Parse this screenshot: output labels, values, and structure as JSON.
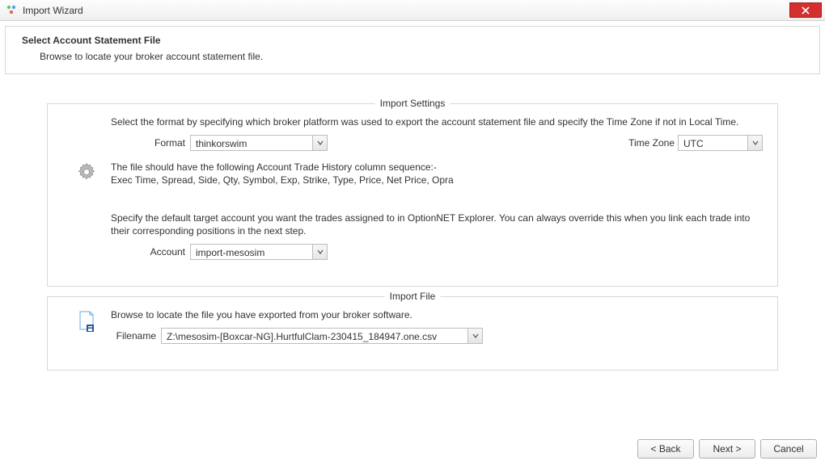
{
  "window": {
    "title": "Import Wizard"
  },
  "header": {
    "title": "Select Account Statement File",
    "subtitle": "Browse to locate your broker account statement file."
  },
  "settings": {
    "legend": "Import Settings",
    "para1": "Select the format by specifying which broker platform was used to export the account statement file and specify the Time Zone if not in Local Time.",
    "format_label": "Format",
    "format_value": "thinkorswim",
    "timezone_label": "Time Zone",
    "timezone_value": "UTC",
    "hint1": "The file should have the following Account Trade History column sequence:-",
    "hint2": "Exec Time, Spread, Side, Qty, Symbol, Exp, Strike, Type, Price, Net Price, Opra",
    "para2": "Specify the default target account you want the trades assigned to in OptionNET Explorer. You can always override this when you link each trade into their corresponding positions in the next step.",
    "account_label": "Account",
    "account_value": "import-mesosim"
  },
  "file": {
    "legend": "Import File",
    "para": "Browse to locate the file you have exported from your broker software.",
    "filename_label": "Filename",
    "filename_value": "Z:\\mesosim-[Boxcar-NG].HurtfulClam-230415_184947.one.csv"
  },
  "buttons": {
    "back": "< Back",
    "next": "Next >",
    "cancel": "Cancel"
  }
}
